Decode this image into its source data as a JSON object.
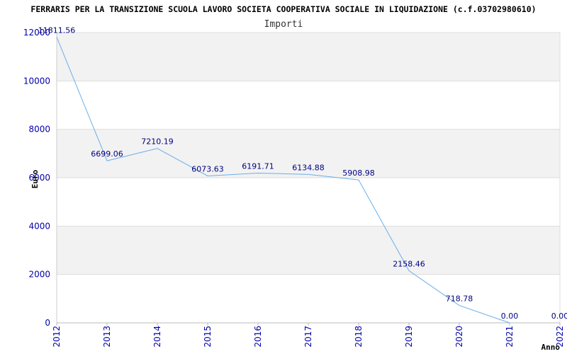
{
  "chart_data": {
    "type": "line",
    "title": "FERRARIS PER LA TRANSIZIONE SCUOLA LAVORO SOCIETA COOPERATIVA SOCIALE IN LIQUIDAZIONE (c.f.03702980610)",
    "subtitle": "Importi",
    "xlabel": "Anno",
    "ylabel": "Euro",
    "categories": [
      "2012",
      "2013",
      "2014",
      "2015",
      "2016",
      "2017",
      "2018",
      "2019",
      "2020",
      "2021",
      "2022"
    ],
    "values": [
      11811.56,
      6699.06,
      7210.19,
      6073.63,
      6191.71,
      6134.88,
      5908.98,
      2158.46,
      718.78,
      0.0,
      null
    ],
    "data_labels": [
      "11811.56",
      "6699.06",
      "7210.19",
      "6073.63",
      "6191.71",
      "6134.88",
      "5908.98",
      "2158.46",
      "718.78",
      "0.00",
      "0.00"
    ],
    "ylim": [
      0,
      12000
    ],
    "yticks": [
      "0",
      "2000",
      "4000",
      "6000",
      "8000",
      "10000",
      "12000"
    ],
    "grid": true,
    "colors": {
      "line": "#6aaee8",
      "band": "#f2f2f2",
      "axis_text": "#0000aa",
      "label_text": "#000080",
      "title_text": "#000000"
    }
  }
}
